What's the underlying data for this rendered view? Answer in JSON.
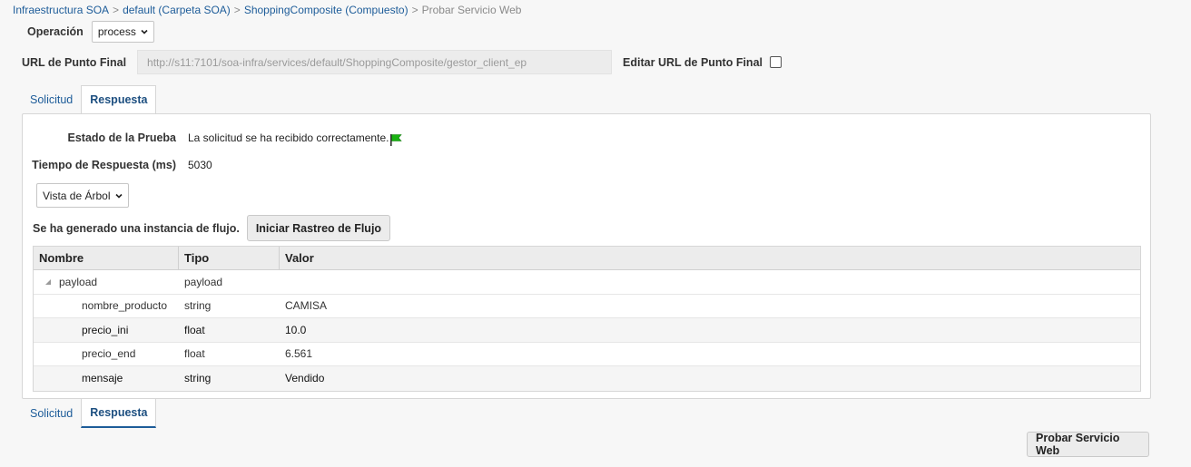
{
  "breadcrumb": {
    "items": [
      "Infraestructura SOA",
      "default (Carpeta SOA)",
      "ShoppingComposite (Compuesto)"
    ],
    "current": "Probar Servicio Web",
    "separator": ">"
  },
  "operation": {
    "label": "Operación",
    "value": "process"
  },
  "endpoint": {
    "label": "URL de Punto Final",
    "value": "http://s11:7101/soa-infra/services/default/ShoppingComposite/gestor_client_ep",
    "edit_label": "Editar URL de Punto Final",
    "edit_checked": false
  },
  "tabs": [
    {
      "label": "Solicitud",
      "active": false
    },
    {
      "label": "Respuesta",
      "active": true
    }
  ],
  "response": {
    "status_label": "Estado de la Prueba",
    "status_value": "La solicitud se ha recibido correctamente.",
    "time_label": "Tiempo de Respuesta (ms)",
    "time_value": "5030",
    "view_select": "Vista de Árbol",
    "flow_text": "Se ha generado una instancia de flujo.",
    "flow_button": "Iniciar Rastreo de Flujo"
  },
  "grid": {
    "headers": [
      "Nombre",
      "Tipo",
      "Valor"
    ],
    "root": {
      "name": "payload",
      "type": "payload",
      "value": ""
    },
    "rows": [
      {
        "name": "nombre_producto",
        "type": "string",
        "value": "CAMISA"
      },
      {
        "name": "precio_ini",
        "type": "float",
        "value": "10.0"
      },
      {
        "name": "precio_end",
        "type": "float",
        "value": "6.561"
      },
      {
        "name": "mensaje",
        "type": "string",
        "value": "Vendido"
      }
    ]
  },
  "submit_button": "Probar Servicio Web",
  "colors": {
    "link": "#1d5c99",
    "flag": "#19b312",
    "panel_border": "#d6d6d6"
  },
  "icons": [
    "chevron-down-icon",
    "flag-icon",
    "tree-collapse-icon"
  ]
}
